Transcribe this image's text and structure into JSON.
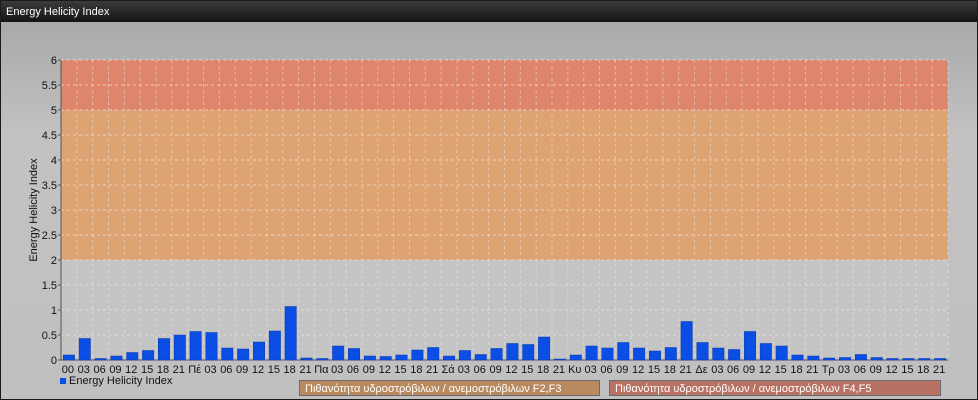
{
  "window": {
    "title": "Energy Helicity Index"
  },
  "legend": {
    "series_label": "Energy Helicity Index"
  },
  "bands": [
    {
      "label": "Πιθανότητα υδροστρόβιλων / ανεμοστρόβιλων F2,F3",
      "from": 2,
      "to": 5,
      "color": "#e0a069"
    },
    {
      "label": "Πιθανότητα υδροστρόβιλων / ανεμοστρόβιλων F4,F5",
      "from": 5,
      "to": 6,
      "color": "#e27e62"
    }
  ],
  "colors": {
    "bar": "#0a4ee6",
    "grid": "#e8e8e8"
  },
  "chart_data": {
    "type": "bar",
    "ylabel": "Energy Helicity Index",
    "ylim": [
      0,
      6
    ],
    "yticks": [
      "0",
      "0.5",
      "1",
      "1.5",
      "2",
      "2.5",
      "3",
      "3.5",
      "4",
      "4.5",
      "5",
      "5.5",
      "6"
    ],
    "categories": [
      "00",
      "03",
      "06",
      "09",
      "12",
      "15",
      "18",
      "21",
      "Πέ",
      "03",
      "06",
      "09",
      "12",
      "15",
      "18",
      "21",
      "Πα",
      "03",
      "06",
      "09",
      "12",
      "15",
      "18",
      "21",
      "Σά",
      "03",
      "06",
      "09",
      "12",
      "15",
      "18",
      "21",
      "Κυ",
      "03",
      "06",
      "09",
      "12",
      "15",
      "18",
      "21",
      "Δε",
      "03",
      "06",
      "09",
      "12",
      "15",
      "18",
      "21",
      "Τρ",
      "03",
      "06",
      "09",
      "12",
      "15",
      "18",
      "21"
    ],
    "series": [
      {
        "name": "Energy Helicity Index",
        "values": [
          0.1,
          0.43,
          0.03,
          0.08,
          0.15,
          0.19,
          0.43,
          0.5,
          0.57,
          0.55,
          0.24,
          0.22,
          0.36,
          0.58,
          1.07,
          0.04,
          0.03,
          0.28,
          0.23,
          0.08,
          0.07,
          0.1,
          0.2,
          0.25,
          0.08,
          0.19,
          0.11,
          0.23,
          0.33,
          0.31,
          0.46,
          0.02,
          0.1,
          0.28,
          0.24,
          0.35,
          0.24,
          0.18,
          0.25,
          0.77,
          0.35,
          0.24,
          0.21,
          0.57,
          0.33,
          0.28,
          0.1,
          0.08,
          0.04,
          0.05,
          0.11,
          0.05,
          0.03,
          0.03,
          0.03,
          0.03
        ]
      }
    ]
  }
}
